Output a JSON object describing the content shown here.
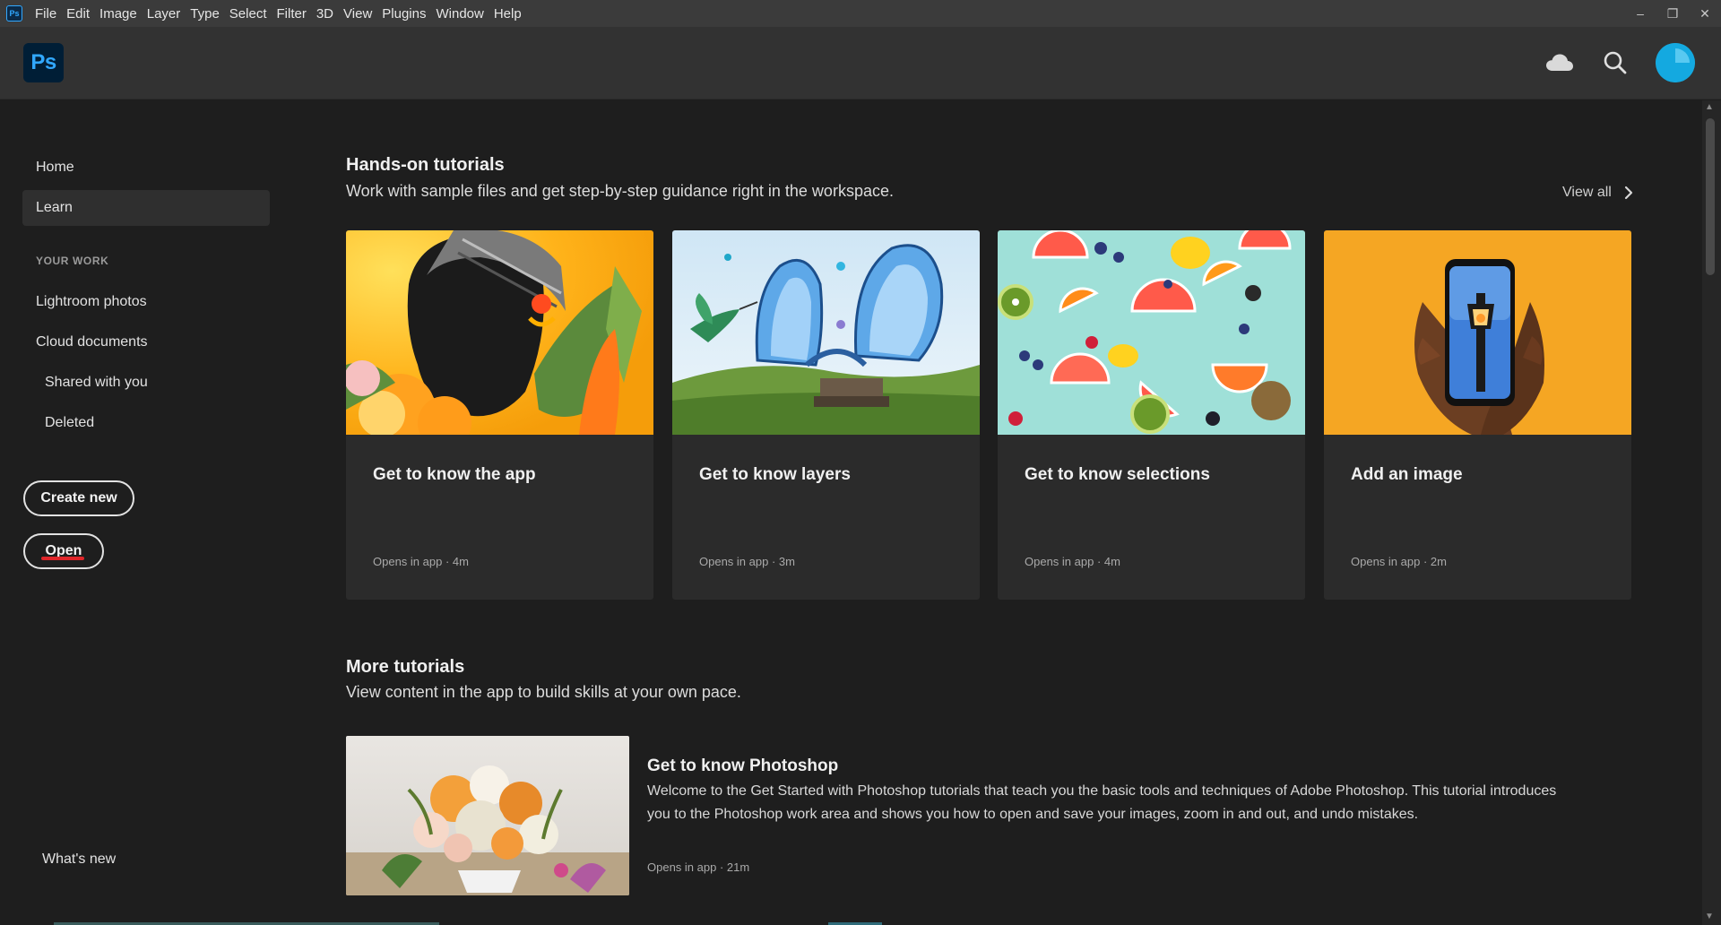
{
  "menubar": {
    "app_icon": "ps-app-icon",
    "items": [
      "File",
      "Edit",
      "Image",
      "Layer",
      "Type",
      "Select",
      "Filter",
      "3D",
      "View",
      "Plugins",
      "Window",
      "Help"
    ]
  },
  "window_controls": {
    "minimize": "–",
    "restore": "❐",
    "close": "✕"
  },
  "header": {
    "logo_text": "Ps",
    "icons": [
      "cloud-icon",
      "search-icon",
      "avatar"
    ]
  },
  "sidebar": {
    "home": "Home",
    "learn": "Learn",
    "your_work_label": "YOUR WORK",
    "lightroom": "Lightroom photos",
    "cloud_docs": "Cloud documents",
    "shared": "Shared with you",
    "deleted": "Deleted",
    "create_new": "Create new",
    "open": "Open",
    "whats_new": "What's new"
  },
  "hands_on": {
    "title": "Hands-on tutorials",
    "subtitle": "Work with sample files and get step-by-step guidance right in the workspace.",
    "view_all": "View all",
    "cards": [
      {
        "title": "Get to know the app",
        "meta": "Opens in app  ·  4m"
      },
      {
        "title": "Get to know layers",
        "meta": "Opens in app  ·  3m"
      },
      {
        "title": "Get to know selections",
        "meta": "Opens in app  ·  4m"
      },
      {
        "title": "Add an image",
        "meta": "Opens in app  ·  2m"
      }
    ]
  },
  "more": {
    "title": "More tutorials",
    "subtitle": "View content in the app to build skills at your own pace.",
    "item": {
      "title": "Get to know Photoshop",
      "description": "Welcome to the Get Started with Photoshop tutorials that teach you the basic tools and techniques of Adobe Photoshop. This tutorial introduces you to the Photoshop work area and shows you how to open and save your images, zoom in and out, and undo mistakes.",
      "meta": "Opens in app  ·  21m"
    }
  },
  "colors": {
    "accent": "#31a8ff",
    "background": "#1e1e1e",
    "card": "#2b2b2b",
    "highlight": "#e0262a"
  }
}
